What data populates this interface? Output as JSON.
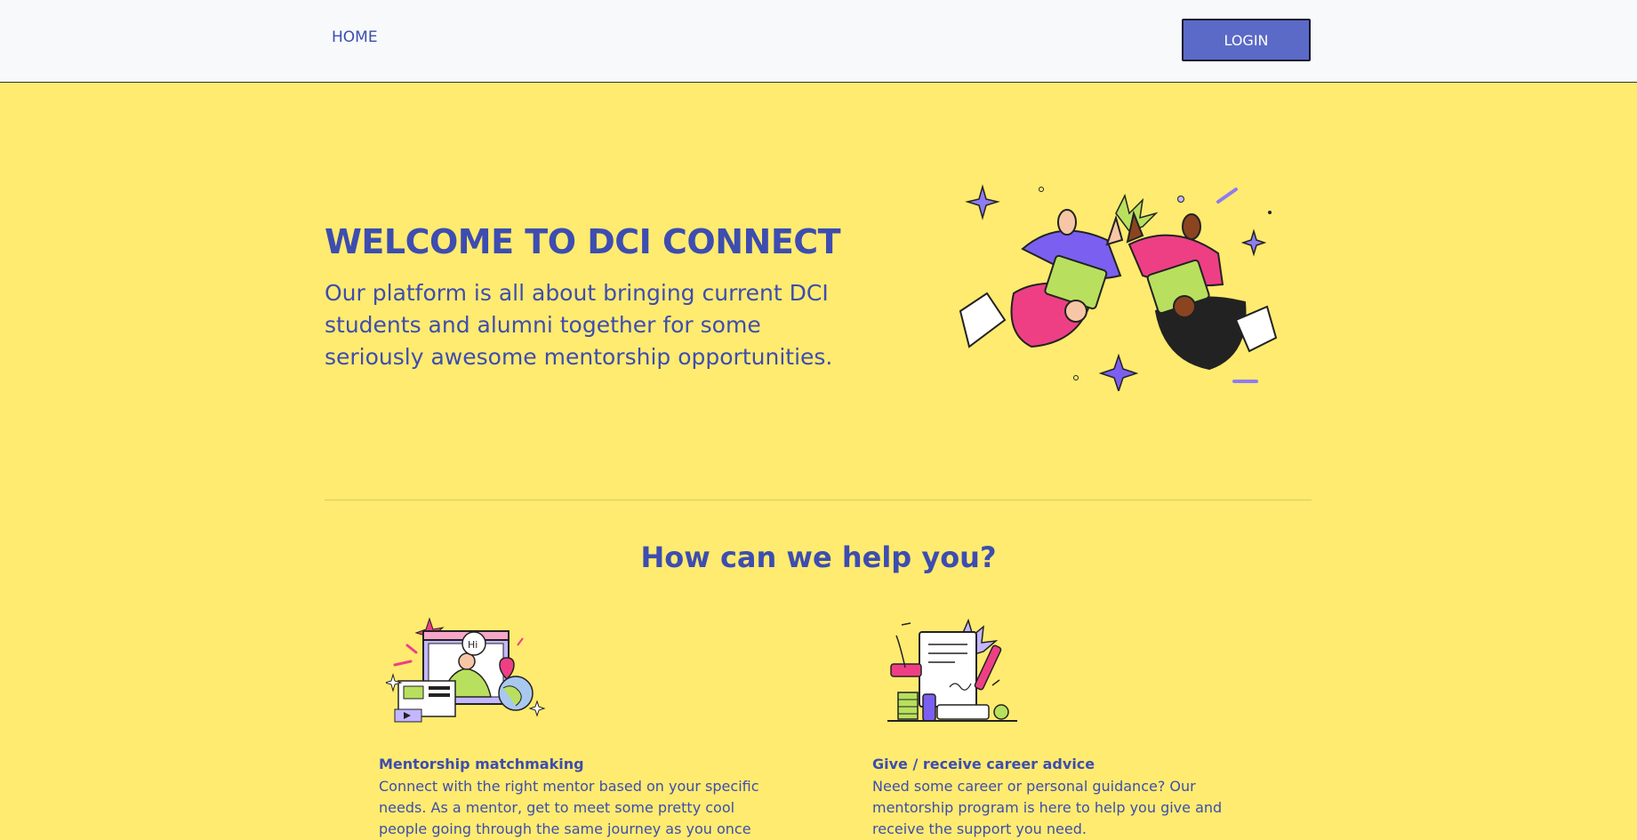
{
  "nav": {
    "home_label": "HOME",
    "login_label": "LOGIN"
  },
  "hero": {
    "title": "WELCOME TO DCI CONNECT",
    "subtitle": "Our platform is all about bringing current DCI students and alumni together for some seriously awesome mentorship opportunities.",
    "illustration": "high-five-illustration"
  },
  "help": {
    "title": "How can we help you?",
    "cards": [
      {
        "title": "Mentorship matchmaking",
        "text": "Connect with the right mentor based on your specific needs. As a mentor, get to meet some pretty cool people going through the same journey as you once",
        "illustration": "video-call-illustration"
      },
      {
        "title": "Give / receive career advice",
        "text": "Need some career or personal guidance? Our mentorship program is here to help you give and receive the support you need.",
        "illustration": "document-illustration"
      }
    ]
  },
  "colors": {
    "background": "#ffeb6f",
    "navbar": "#f8f9fb",
    "primary_text": "#3d4db0",
    "button": "#5b6ac7"
  }
}
